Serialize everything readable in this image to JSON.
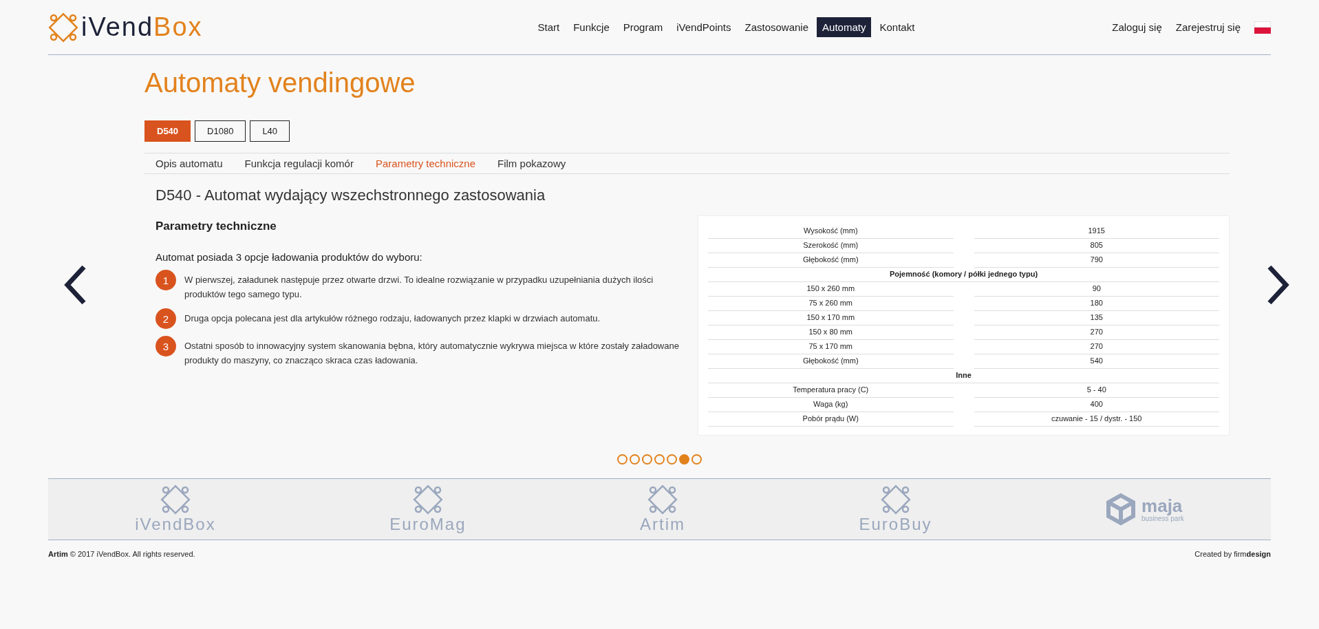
{
  "header": {
    "logo": {
      "primary": "iVend",
      "secondary": "Box"
    },
    "nav": [
      {
        "label": "Start",
        "selected": false
      },
      {
        "label": "Funkcje",
        "selected": false
      },
      {
        "label": "Program",
        "selected": false
      },
      {
        "label": "iVendPoints",
        "selected": false
      },
      {
        "label": "Zastosowanie",
        "selected": false
      },
      {
        "label": "Automaty",
        "selected": true
      },
      {
        "label": "Kontakt",
        "selected": false
      }
    ],
    "account": [
      "Zaloguj się",
      "Zarejestruj się"
    ]
  },
  "page_title": "Automaty vendingowe",
  "models": [
    {
      "label": "D540",
      "selected": true
    },
    {
      "label": "D1080",
      "selected": false
    },
    {
      "label": "L40",
      "selected": false
    }
  ],
  "subtabs": [
    {
      "label": "Opis automatu",
      "selected": false
    },
    {
      "label": "Funkcja regulacji komór",
      "selected": false
    },
    {
      "label": "Parametry techniczne",
      "selected": true
    },
    {
      "label": "Film pokazowy",
      "selected": false
    }
  ],
  "product_title": "D540 - Automat wydający wszechstronnego zastosowania",
  "section_heading": "Parametry techniczne",
  "intro": "Automat posiada 3 opcje ładowania produktów do wyboru:",
  "options": [
    {
      "number": "1",
      "text": "W pierwszej, załadunek następuje przez otwarte drzwi. To idealne rozwiązanie w przypadku uzupełniania dużych ilości produktów tego samego typu."
    },
    {
      "number": "2",
      "text": "Druga opcja polecana jest dla artykułów różnego rodzaju, ładowanych przez klapki w drzwiach automatu."
    },
    {
      "number": "3",
      "text": "Ostatni sposób to innowacyjny system skanowania bębna, który automatycznie wykrywa miejsca w które zostały załadowane produkty do maszyny, co znacząco skraca czas ładowania."
    }
  ],
  "spec_table": [
    {
      "kind": "pair",
      "label": "Wysokość (mm)",
      "value": "1915"
    },
    {
      "kind": "pair",
      "label": "Szerokość (mm)",
      "value": "805"
    },
    {
      "kind": "pair",
      "label": "Głębokość (mm)",
      "value": "790"
    },
    {
      "kind": "section",
      "label": "Pojemność (komory / półki jednego typu)"
    },
    {
      "kind": "pair",
      "label": "150 x 260 mm",
      "value": "90"
    },
    {
      "kind": "pair",
      "label": "75 x 260 mm",
      "value": "180"
    },
    {
      "kind": "pair",
      "label": "150 x 170 mm",
      "value": "135"
    },
    {
      "kind": "pair",
      "label": "150 x 80 mm",
      "value": "270"
    },
    {
      "kind": "pair",
      "label": "75 x 170 mm",
      "value": "270"
    },
    {
      "kind": "pair",
      "label": "Głębokość (mm)",
      "value": "540"
    },
    {
      "kind": "section",
      "label": "Inne"
    },
    {
      "kind": "pair",
      "label": "Temperatura pracy (C)",
      "value": "5 - 40"
    },
    {
      "kind": "pair",
      "label": "Waga (kg)",
      "value": "400"
    },
    {
      "kind": "pair",
      "label": "Pobór prądu (W)",
      "value": "czuwanie - 15 / dystr. - 150"
    }
  ],
  "slider_dots": [
    {
      "selected": false
    },
    {
      "selected": false
    },
    {
      "selected": false
    },
    {
      "selected": false
    },
    {
      "selected": false
    },
    {
      "selected": true
    },
    {
      "selected": false
    }
  ],
  "partners": [
    {
      "kind": "ivendbox",
      "name": "iVendBox"
    },
    {
      "kind": "euromag",
      "name": "EuroMag"
    },
    {
      "kind": "artim",
      "name": "Artim"
    },
    {
      "kind": "eurobuy",
      "name": "EuroBuy"
    },
    {
      "kind": "maja",
      "name": "maja",
      "subtitle": "business park"
    }
  ],
  "footer": {
    "copyright": "**Artim** © 2017 iVendBox. All rights reserved.",
    "credit": "Created by firm**design**"
  }
}
